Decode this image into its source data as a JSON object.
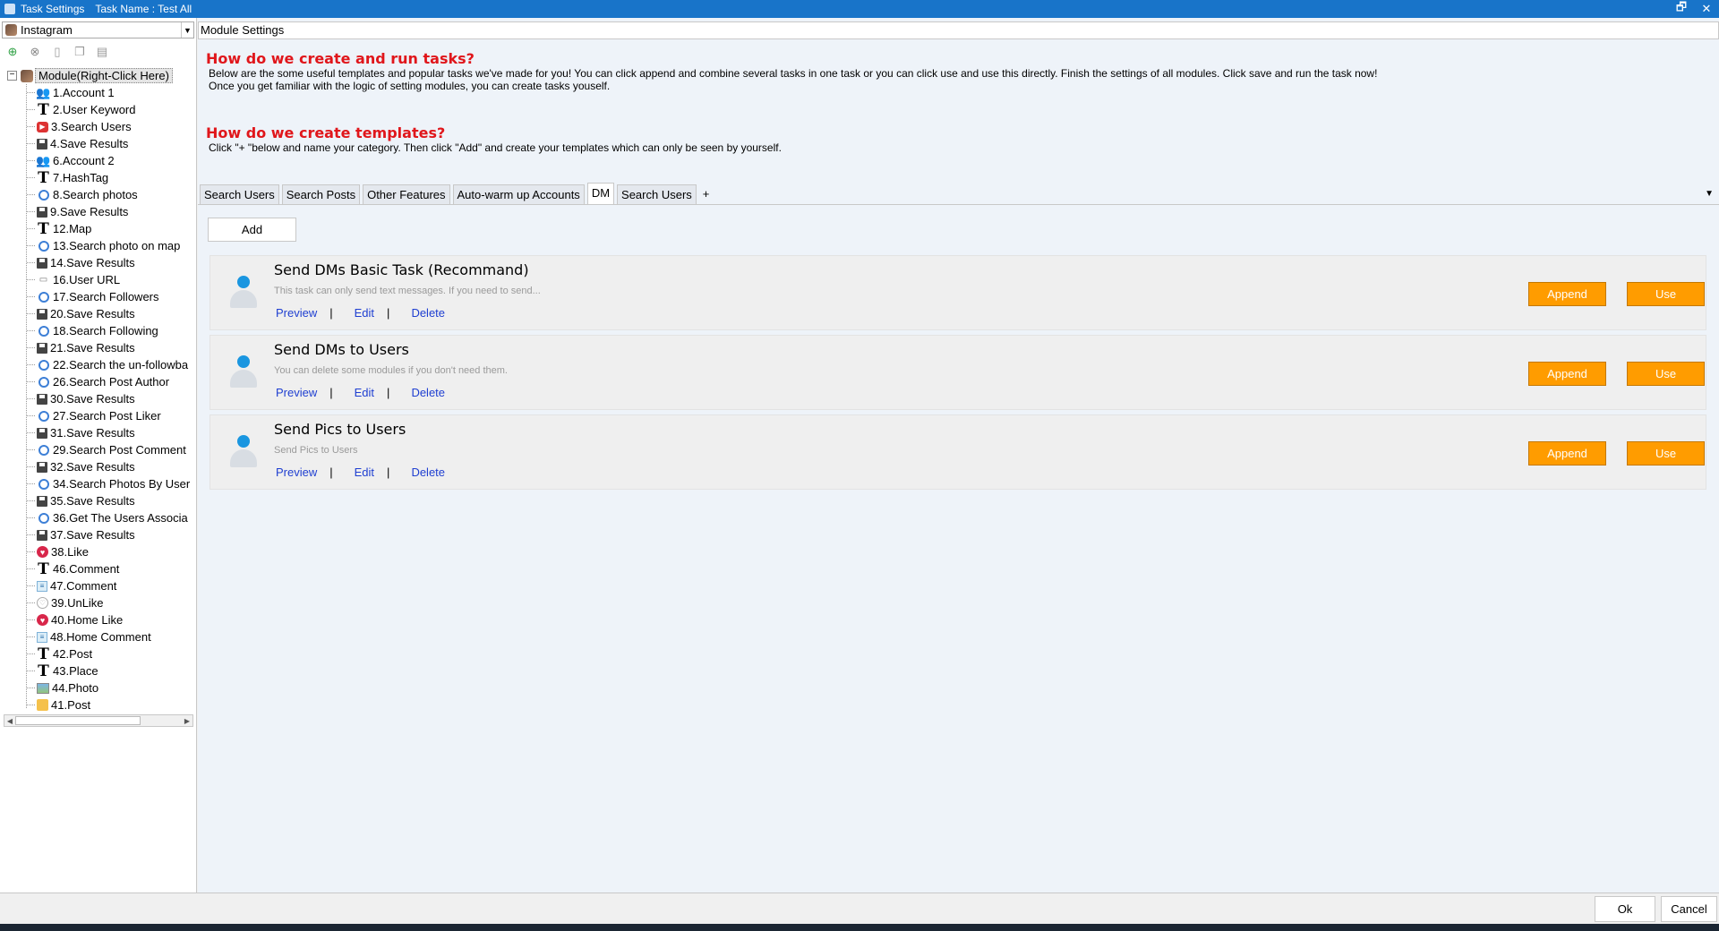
{
  "window": {
    "title": "Task Settings",
    "task_name": "Task Name : Test All",
    "restore_symbol": "🗗",
    "close_symbol": "✕"
  },
  "left_panel": {
    "platform": "Instagram",
    "root_label": "Module(Right-Click Here)",
    "root_expander": "−",
    "tree_items": [
      {
        "label": "1.Account 1",
        "icon": "account-icon",
        "glyph": "👥",
        "cls": "ico-acct"
      },
      {
        "label": "2.User Keyword",
        "icon": "text-icon",
        "glyph": "T",
        "cls": "ico-T"
      },
      {
        "label": "3.Search Users",
        "icon": "video-icon",
        "glyph": "▶",
        "cls": "ico-yt"
      },
      {
        "label": "4.Save Results",
        "icon": "save-icon",
        "glyph": "",
        "cls": "ico-save"
      },
      {
        "label": "6.Account 2",
        "icon": "account-icon",
        "glyph": "👥",
        "cls": "ico-acct"
      },
      {
        "label": "7.HashTag",
        "icon": "text-icon",
        "glyph": "T",
        "cls": "ico-T"
      },
      {
        "label": "8.Search photos",
        "icon": "search-icon",
        "glyph": "",
        "cls": "ico-search"
      },
      {
        "label": "9.Save Results",
        "icon": "save-icon",
        "glyph": "",
        "cls": "ico-save"
      },
      {
        "label": "12.Map",
        "icon": "text-icon",
        "glyph": "T",
        "cls": "ico-T"
      },
      {
        "label": "13.Search photo on map",
        "icon": "search-icon",
        "glyph": "",
        "cls": "ico-search"
      },
      {
        "label": "14.Save Results",
        "icon": "save-icon",
        "glyph": "",
        "cls": "ico-save"
      },
      {
        "label": "16.User URL",
        "icon": "url-icon",
        "glyph": "▭",
        "cls": "ico-url"
      },
      {
        "label": "17.Search Followers",
        "icon": "search-icon",
        "glyph": "",
        "cls": "ico-search"
      },
      {
        "label": "20.Save Results",
        "icon": "save-icon",
        "glyph": "",
        "cls": "ico-save"
      },
      {
        "label": "18.Search Following",
        "icon": "search-icon",
        "glyph": "",
        "cls": "ico-search"
      },
      {
        "label": "21.Save Results",
        "icon": "save-icon",
        "glyph": "",
        "cls": "ico-save"
      },
      {
        "label": "22.Search the un-followba",
        "icon": "search-icon",
        "glyph": "",
        "cls": "ico-search"
      },
      {
        "label": "26.Search Post Author",
        "icon": "search-icon",
        "glyph": "",
        "cls": "ico-search"
      },
      {
        "label": "30.Save Results",
        "icon": "save-icon",
        "glyph": "",
        "cls": "ico-save"
      },
      {
        "label": "27.Search Post Liker",
        "icon": "search-icon",
        "glyph": "",
        "cls": "ico-search"
      },
      {
        "label": "31.Save Results",
        "icon": "save-icon",
        "glyph": "",
        "cls": "ico-save"
      },
      {
        "label": "29.Search Post Comment",
        "icon": "search-icon",
        "glyph": "",
        "cls": "ico-search"
      },
      {
        "label": "32.Save Results",
        "icon": "save-icon",
        "glyph": "",
        "cls": "ico-save"
      },
      {
        "label": "34.Search Photos By User",
        "icon": "search-icon",
        "glyph": "",
        "cls": "ico-search"
      },
      {
        "label": "35.Save Results",
        "icon": "save-icon",
        "glyph": "",
        "cls": "ico-save"
      },
      {
        "label": "36.Get The Users Associa",
        "icon": "search-icon",
        "glyph": "",
        "cls": "ico-search"
      },
      {
        "label": "37.Save Results",
        "icon": "save-icon",
        "glyph": "",
        "cls": "ico-save"
      },
      {
        "label": "38.Like",
        "icon": "heart-icon",
        "glyph": "♥",
        "cls": "ico-heart"
      },
      {
        "label": "46.Comment",
        "icon": "text-icon",
        "glyph": "T",
        "cls": "ico-T"
      },
      {
        "label": "47.Comment",
        "icon": "comment-icon",
        "glyph": "≡",
        "cls": "ico-cmt"
      },
      {
        "label": "39.UnLike",
        "icon": "unlike-icon",
        "glyph": "♡",
        "cls": "ico-heartoff"
      },
      {
        "label": "40.Home Like",
        "icon": "heart-icon",
        "glyph": "♥",
        "cls": "ico-heart"
      },
      {
        "label": "48.Home Comment",
        "icon": "comment-icon",
        "glyph": "≡",
        "cls": "ico-cmt"
      },
      {
        "label": "42.Post",
        "icon": "text-icon",
        "glyph": "T",
        "cls": "ico-T"
      },
      {
        "label": "43.Place",
        "icon": "text-icon",
        "glyph": "T",
        "cls": "ico-T"
      },
      {
        "label": "44.Photo",
        "icon": "photo-icon",
        "glyph": "",
        "cls": "ico-photo"
      },
      {
        "label": "41.Post",
        "icon": "post-icon",
        "glyph": "",
        "cls": "ico-post"
      }
    ]
  },
  "right_panel": {
    "module_settings": "Module Settings",
    "help1_title": "How do we create and run tasks?",
    "help1_line1": "Below are the some useful templates and popular tasks we've made for you!  You can click append and combine several tasks in one task or you can click use and use this directly. Finish the settings of all modules. Click save and run the task now!",
    "help1_line2": "Once you get familiar with the logic of setting modules, you can create tasks youself.",
    "help2_title": "How do we create templates?",
    "help2_line1": "Click \"+ \"below and name your category. Then click \"Add\" and create your templates which can only be seen by yourself.",
    "tabs": [
      "Search Users",
      "Search Posts",
      "Other Features",
      "Auto-warm up Accounts",
      "DM",
      "Search Users"
    ],
    "tab_plus": "+",
    "active_tab": "DM",
    "tab_menu_symbol": "▼",
    "add_label": "Add",
    "templates": [
      {
        "title": "Send DMs Basic Task (Recommand)",
        "desc": "This task can only send text messages. If you need to send..."
      },
      {
        "title": "Send DMs to Users",
        "desc": "You can delete some modules if you don't need them."
      },
      {
        "title": "Send Pics to Users",
        "desc": "Send Pics to Users"
      }
    ],
    "card_labels": {
      "preview": "Preview",
      "edit": "Edit",
      "delete": "Delete",
      "separator": "|",
      "append": "Append",
      "use": "Use"
    }
  },
  "bottom": {
    "ok": "Ok",
    "cancel": "Cancel"
  },
  "colors": {
    "titlebar": "#1874c9",
    "help_title": "#e0161b",
    "action_button": "#ff9c00",
    "link": "#1f3fd1"
  }
}
